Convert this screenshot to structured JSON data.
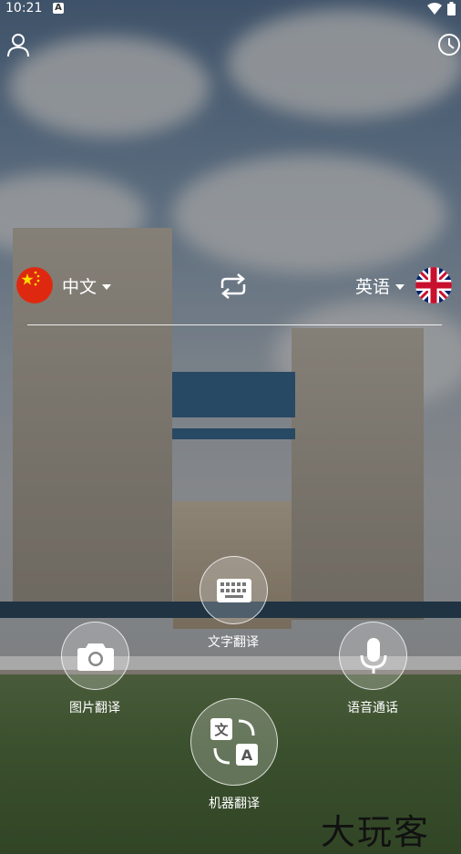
{
  "status_bar": {
    "time": "10:21",
    "badge": "A"
  },
  "source_language": {
    "label": "中文",
    "flag": "china-flag"
  },
  "target_language": {
    "label": "英语",
    "flag": "uk-flag"
  },
  "actions": {
    "text": {
      "label": "文字翻译",
      "icon": "keyboard-icon"
    },
    "photo": {
      "label": "图片翻译",
      "icon": "camera-icon"
    },
    "voice": {
      "label": "语音通话",
      "icon": "microphone-icon"
    },
    "machine": {
      "label": "机器翻译",
      "icon": "translate-icon"
    }
  },
  "watermark": "大玩客",
  "colors": {
    "accent_red": "#de2910",
    "uk_blue": "#012169",
    "uk_red": "#c8102e"
  }
}
